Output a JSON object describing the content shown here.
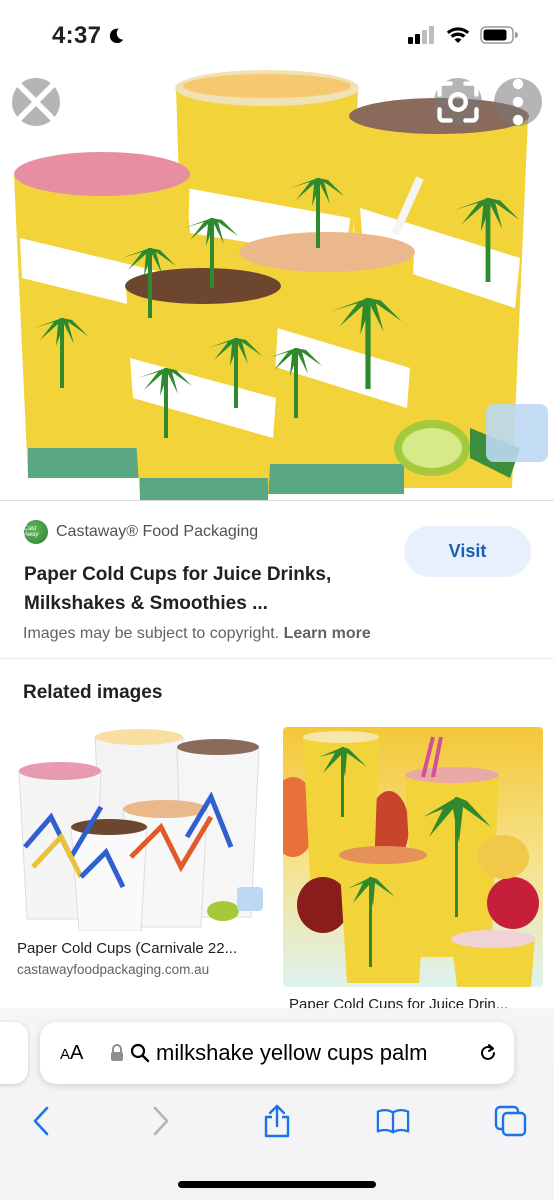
{
  "status_bar": {
    "time": "4:37"
  },
  "hero": {
    "close_icon": "close-icon",
    "lens_icon": "lens-icon",
    "more_icon": "more-vert-icon"
  },
  "result": {
    "source_name": "Castaway® Food Packaging",
    "favicon_text": "Cast Away",
    "title_line1": "Paper Cold Cups for Juice Drinks,",
    "title_line2": "Milkshakes & Smoothies ...",
    "visit_label": "Visit",
    "copyright_text": "Images may be subject to copyright.",
    "learn_more": "Learn more"
  },
  "related": {
    "heading": "Related images",
    "items": [
      {
        "title": "Paper Cold Cups (Carnivale 22...",
        "source": "castawayfoodpackaging.com.au"
      },
      {
        "title": "Paper Cold Cups for Juice Drin...",
        "source": ""
      }
    ]
  },
  "address_bar": {
    "aa_label_small": "A",
    "aa_label": "A",
    "url": "milkshake yellow cups palm"
  },
  "toolbar": {
    "back": "chevron-left-icon",
    "forward": "chevron-right-icon",
    "share": "share-icon",
    "bookmarks": "book-icon",
    "tabs": "tabs-icon"
  },
  "colors": {
    "cup_yellow": "#f2d43a",
    "palm_green": "#2f8a2e",
    "cup_base_green": "#5aa784",
    "visit_bg": "#e8f0fe",
    "visit_text": "#1a5fb4"
  }
}
